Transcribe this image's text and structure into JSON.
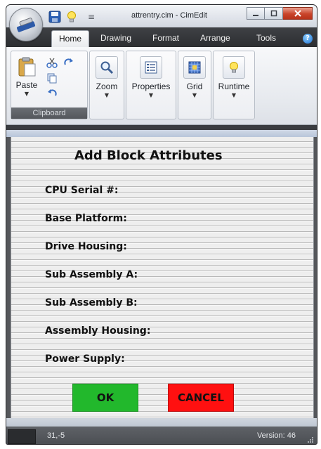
{
  "window": {
    "title": "attrentry.cim - CimEdit"
  },
  "quick_access": {
    "save_icon": "save-icon",
    "bulb_icon": "lightbulb-icon",
    "customize_glyph": "≡"
  },
  "ribbon": {
    "tabs": [
      "Home",
      "Drawing",
      "Format",
      "Arrange",
      "Tools"
    ],
    "active_tab": "Home",
    "clipboard": {
      "paste_label": "Paste",
      "group_label": "Clipboard"
    },
    "zoom_label": "Zoom",
    "properties_label": "Properties",
    "grid_label": "Grid",
    "runtime_label": "Runtime"
  },
  "form": {
    "title": "Add Block Attributes",
    "fields": [
      "CPU Serial #:",
      "Base Platform:",
      "Drive Housing:",
      "Sub Assembly A:",
      "Sub Assembly B:",
      "Assembly Housing:",
      "Power Supply:"
    ],
    "ok_label": "OK",
    "cancel_label": "CANCEL",
    "ok_color": "#22b82c",
    "cancel_color": "#ff1010"
  },
  "status": {
    "coords": "31,-5",
    "version": "Version: 46"
  }
}
